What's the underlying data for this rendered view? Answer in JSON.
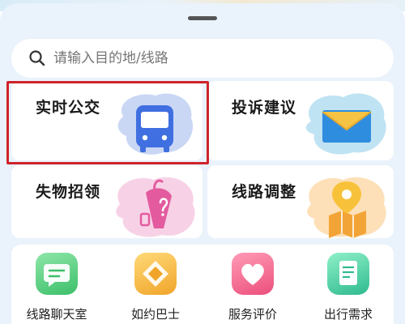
{
  "search": {
    "placeholder": "请输入目的地/线路"
  },
  "cards": [
    {
      "label": "实时公交",
      "icon": "bus-icon"
    },
    {
      "label": "投诉建议",
      "icon": "envelope-icon"
    },
    {
      "label": "失物招领",
      "icon": "umbrella-icon"
    },
    {
      "label": "线路调整",
      "icon": "map-pin-icon"
    }
  ],
  "shortcuts": [
    {
      "label": "线路聊天室",
      "icon": "chat-icon",
      "color": "#4fc97a"
    },
    {
      "label": "如约巴士",
      "icon": "diamond-icon",
      "color": "#f4b63a"
    },
    {
      "label": "服务评价",
      "icon": "heart-icon",
      "color": "#f36a8d"
    },
    {
      "label": "出行需求",
      "icon": "document-icon",
      "color": "#3ec6a0"
    }
  ],
  "colors": {
    "accent": "#3f8ef5",
    "highlight": "#d0232a",
    "background": "#eaf2fb"
  }
}
